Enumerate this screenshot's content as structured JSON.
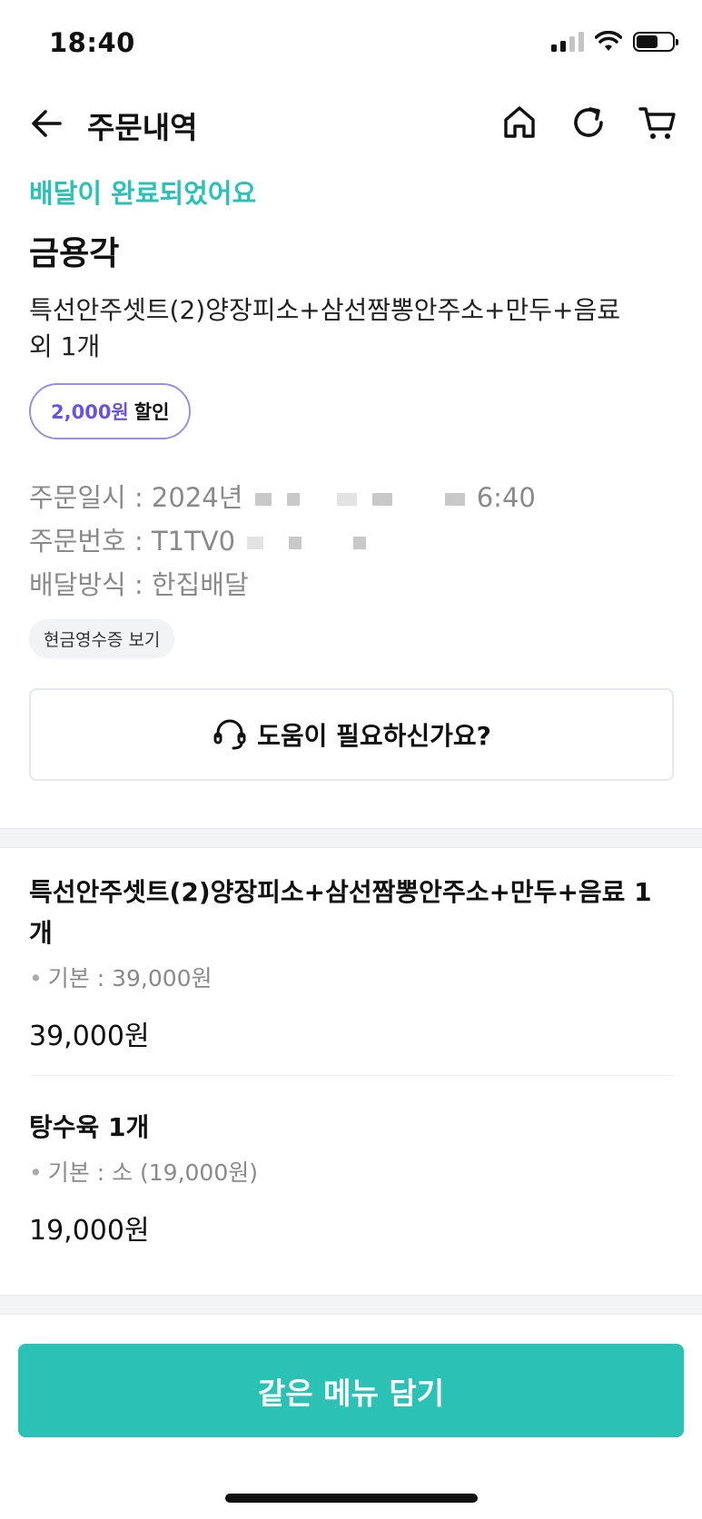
{
  "status_bar": {
    "time": "18:40"
  },
  "header": {
    "title": "주문내역",
    "icons": [
      "back-arrow-icon",
      "home-icon",
      "refresh-icon",
      "cart-icon"
    ]
  },
  "order": {
    "status_text": "배달이 완료되었어요",
    "store_name": "금용각",
    "title_line1": "특선안주셋트(2)양장피소+삼선짬뽕안주소+만두+음료",
    "title_line2": "외 1개",
    "discount_amount": "2,000원",
    "discount_label": "할인",
    "date_label": "주문일시 : 2024년",
    "date_tail": "6:40",
    "number_label": "주문번호 : T1TV0",
    "method_text": "배달방식 : 한집배달",
    "receipt_button": "현금영수증 보기"
  },
  "help": {
    "label": "도움이 필요하신가요?"
  },
  "items": [
    {
      "name": "특선안주셋트(2)양장피소+삼선짬뽕안주소+만두+음료 1개",
      "option": "기본 : 39,000원",
      "price": "39,000원"
    },
    {
      "name": "탕수육 1개",
      "option": "기본 : 소 (19,000원)",
      "price": "19,000원"
    }
  ],
  "cta": {
    "label": "같은 메뉴 담기"
  },
  "colors": {
    "accent": "#2bc1b4",
    "discount": "#6a55d8",
    "badge_border": "#9b8fe0"
  }
}
